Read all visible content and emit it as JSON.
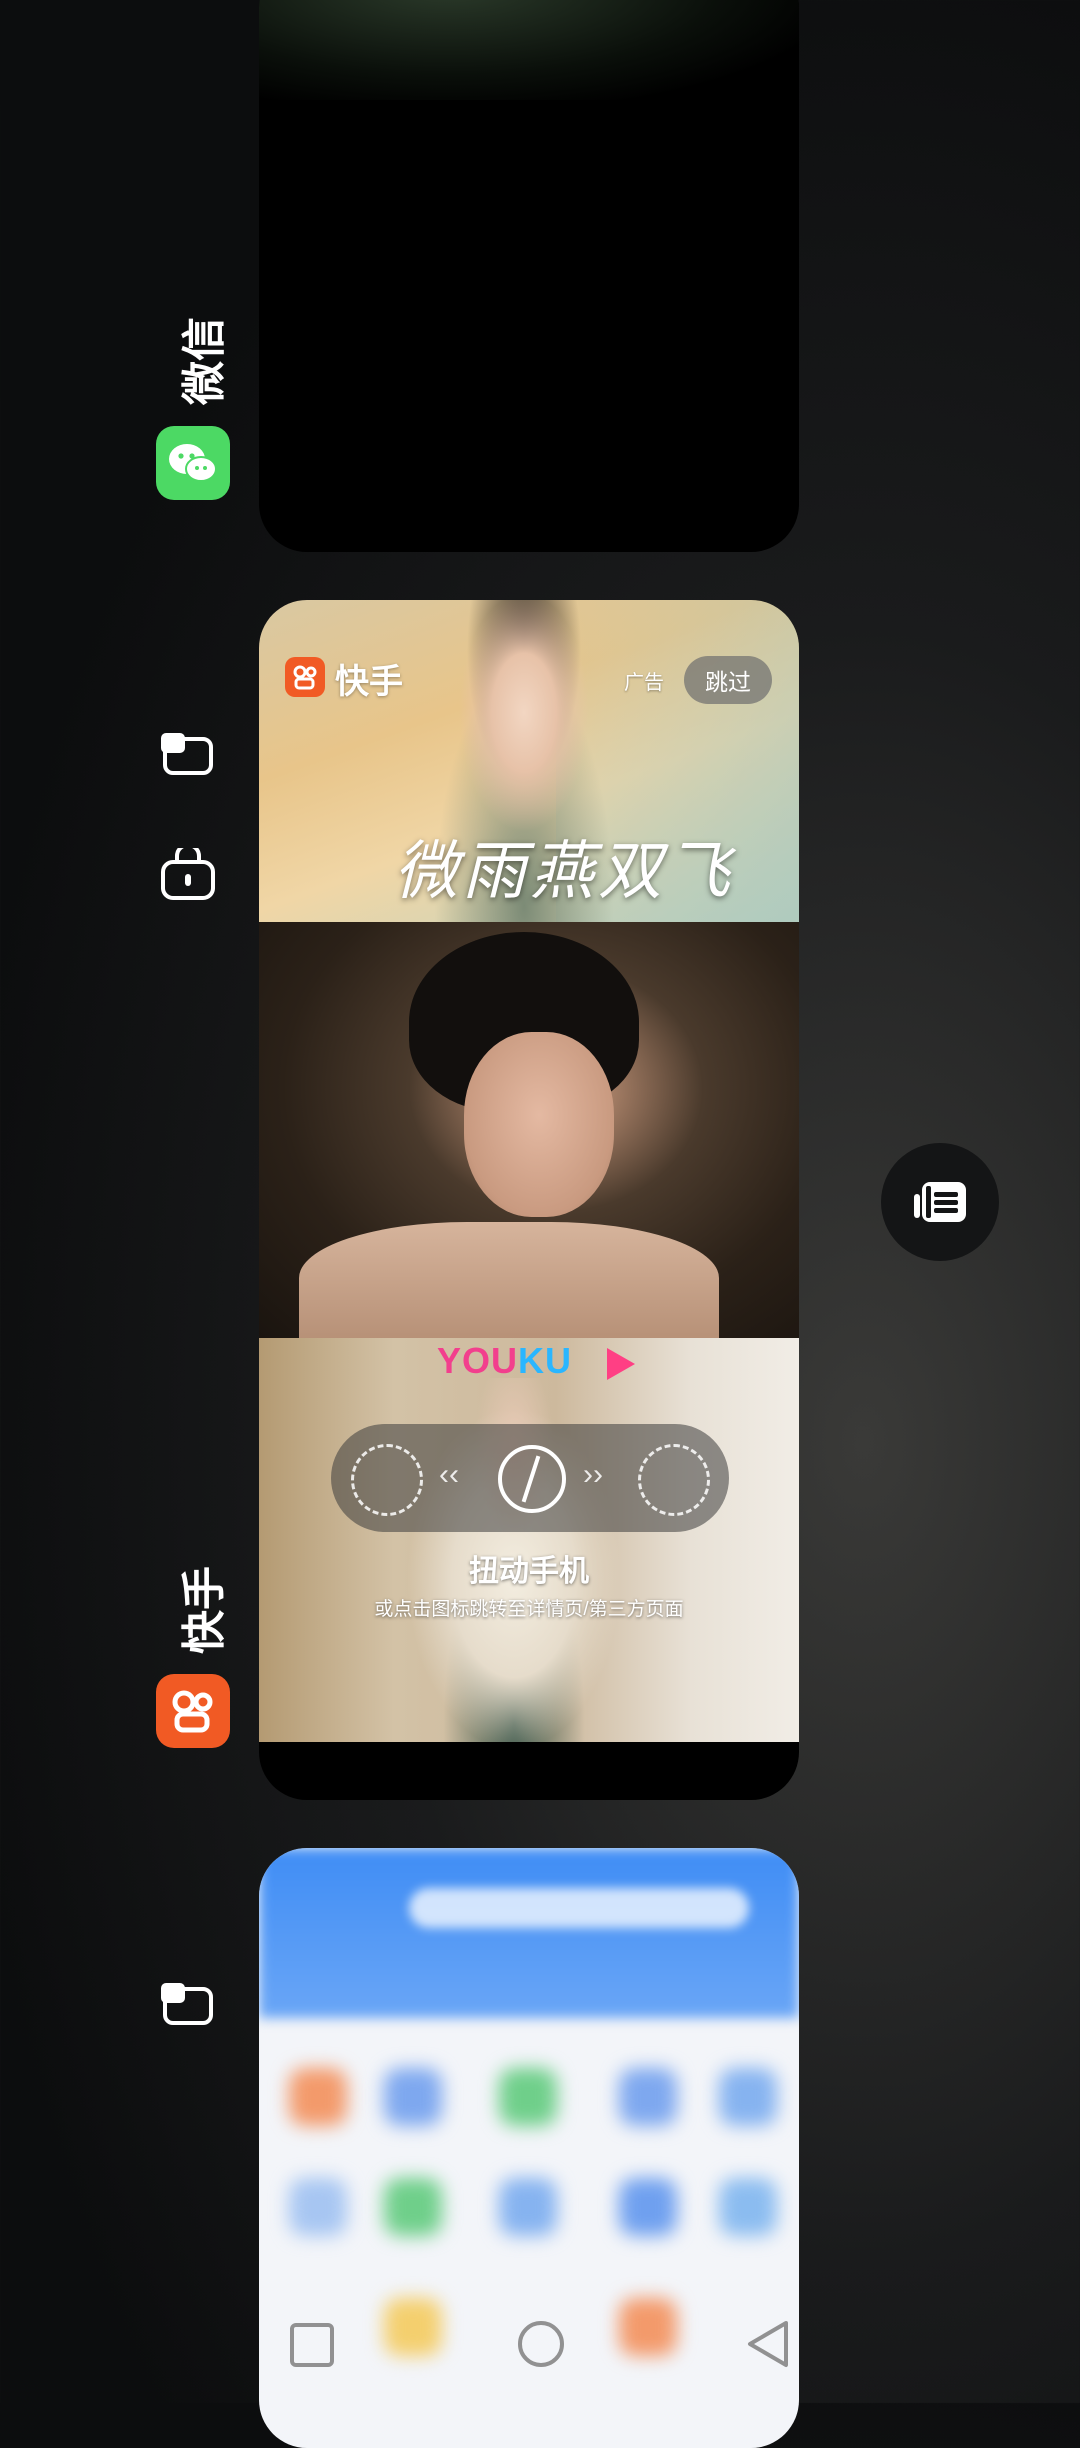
{
  "recent_apps": {
    "wechat": {
      "name": "微信",
      "icon": "wechat-icon",
      "brand_color": "#4cd964"
    },
    "kuaishou": {
      "name": "快手",
      "icon": "kuaishou-icon",
      "brand_color": "#f15a24",
      "preview": {
        "logo_text": "快手",
        "ad_label": "广告",
        "skip_label": "跳过",
        "calligraphy_title": "微雨燕双飞",
        "youku_brand_part1": "YOU",
        "youku_brand_part2": "KU",
        "twist_title": "扭动手机",
        "twist_subtitle": "或点击图标跳转至详情页/第三方页面"
      }
    }
  },
  "side_icons": {
    "card2_window": "floating-window-icon",
    "card2_lock": "lock-app-icon",
    "card3_window": "floating-window-icon"
  },
  "split_screen_button": "split-screen-icon",
  "nav": {
    "recents": "square-icon",
    "home": "circle-icon",
    "back": "triangle-back-icon"
  }
}
